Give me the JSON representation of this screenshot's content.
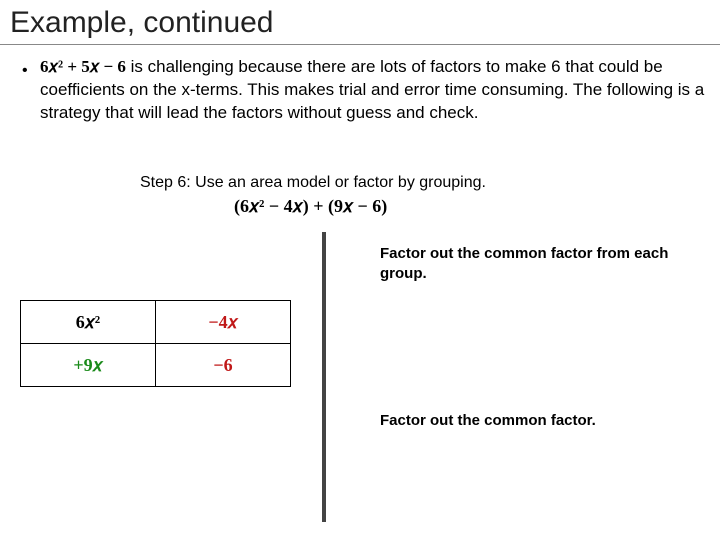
{
  "title": "Example, continued",
  "intro": {
    "expression": "6𝑥² + 5𝑥 − 6",
    "rest": " is challenging because there are lots of factors to make 6 that could be coefficients on the x-terms. This makes trial and error time consuming. The following is a strategy that will lead the factors without guess and check."
  },
  "step_line": "Step 6: Use an area model or factor by grouping.",
  "grouped_expression": "(6𝑥² − 4𝑥) + (9𝑥 − 6)",
  "instruction1": "Factor out the common factor from each group.",
  "instruction2": "Factor out the common factor.",
  "area_model": {
    "cells": {
      "r0c0": "6𝑥²",
      "r0c1": "−4𝑥",
      "r1c0": "+9𝑥",
      "r1c1": "−6"
    }
  },
  "bullet": "•"
}
